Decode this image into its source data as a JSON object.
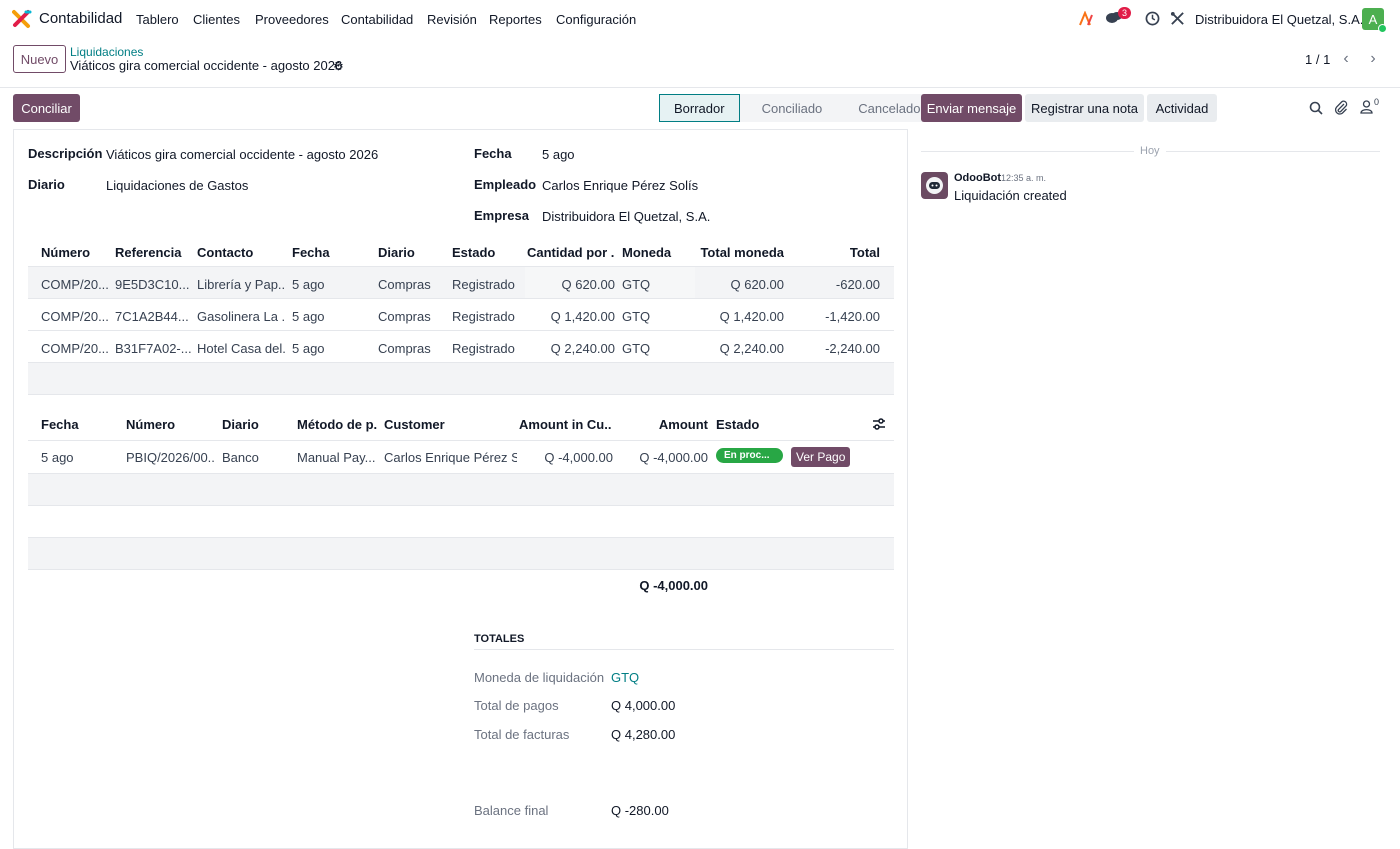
{
  "navbar": {
    "app_name": "Contabilidad",
    "menu": [
      "Tablero",
      "Clientes",
      "Proveedores",
      "Contabilidad",
      "Revisión",
      "Reportes",
      "Configuración"
    ],
    "messages_count": "3",
    "company": "Distribuidora El Quetzal, S.A.",
    "avatar_letter": "A"
  },
  "control": {
    "new_label": "Nuevo",
    "breadcrumb": "Liquidaciones",
    "record_title": "Viáticos gira comercial occidente - agosto 2026",
    "pager": "1 / 1"
  },
  "form": {
    "reconcile_label": "Conciliar",
    "stages": [
      "Borrador",
      "Conciliado",
      "Cancelado"
    ],
    "active_stage": "Borrador",
    "fields": {
      "descripcion_label": "Descripción",
      "descripcion": "Viáticos gira comercial occidente - agosto 2026",
      "diario_label": "Diario",
      "diario": "Liquidaciones de Gastos",
      "fecha_label": "Fecha",
      "fecha": "5 ago",
      "empleado_label": "Empleado",
      "empleado": "Carlos Enrique Pérez Solís",
      "empresa_label": "Empresa",
      "empresa": "Distribuidora El Quetzal, S.A."
    },
    "invoices": {
      "headers": [
        "Número",
        "Referencia",
        "Contacto",
        "Fecha",
        "Diario",
        "Estado",
        "Cantidad por ...",
        "Moneda",
        "Total moneda",
        "Total"
      ],
      "rows": [
        [
          "COMP/20...",
          "9E5D3C10...",
          "Librería y Pap...",
          "5 ago",
          "Compras",
          "Registrado",
          "Q 620.00",
          "GTQ",
          "Q 620.00",
          "-620.00"
        ],
        [
          "COMP/20...",
          "7C1A2B44...",
          "Gasolinera La ...",
          "5 ago",
          "Compras",
          "Registrado",
          "Q 1,420.00",
          "GTQ",
          "Q 1,420.00",
          "-1,420.00"
        ],
        [
          "COMP/20...",
          "B31F7A02-...",
          "Hotel Casa del...",
          "5 ago",
          "Compras",
          "Registrado",
          "Q 2,240.00",
          "GTQ",
          "Q 2,240.00",
          "-2,240.00"
        ]
      ]
    },
    "payments": {
      "headers": [
        "Fecha",
        "Número",
        "Diario",
        "Método de p...",
        "Customer",
        "Amount in Cu...",
        "Amount",
        "Estado"
      ],
      "rows": [
        [
          "5 ago",
          "PBIQ/2026/00...",
          "Banco",
          "Manual Pay...",
          "Carlos Enrique Pérez S...",
          "Q -4,000.00",
          "Q -4,000.00",
          "En proc..."
        ]
      ],
      "view_payment_label": "Ver Pago",
      "total": "Q -4,000.00"
    },
    "totals": {
      "title": "TOTALES",
      "moneda_label": "Moneda de liquidación",
      "moneda": "GTQ",
      "pagos_label": "Total de pagos",
      "pagos": "Q 4,000.00",
      "facturas_label": "Total de facturas",
      "facturas": "Q 4,280.00",
      "balance_label": "Balance final",
      "balance": "Q -280.00"
    }
  },
  "chatter": {
    "send_message": "Enviar mensaje",
    "log_note": "Registrar una nota",
    "activity": "Actividad",
    "followers_count": "0",
    "date_separator": "Hoy",
    "message": {
      "author": "OdooBot",
      "time": "12:35 a. m.",
      "body": "Liquidación created"
    }
  },
  "colors": {
    "primary": "#714B67",
    "link": "#017e84",
    "success": "#28a745"
  }
}
